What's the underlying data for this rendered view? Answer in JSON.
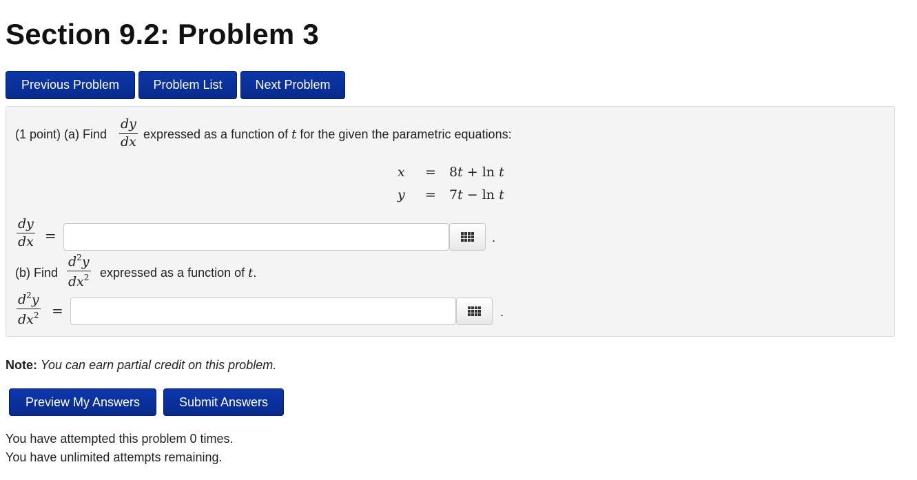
{
  "page": {
    "title": "Section 9.2: Problem 3"
  },
  "nav": {
    "previous_label": "Previous Problem",
    "list_label": "Problem List",
    "next_label": "Next Problem"
  },
  "problem": {
    "part_a": {
      "prefix": "(1 point) (a) Find",
      "frac_num": "dy",
      "frac_den": "dx",
      "suffix_1": "expressed as a function of",
      "var": "t",
      "suffix_2": "for the given the parametric equations:"
    },
    "equations": [
      {
        "lhs": "x",
        "eq": "=",
        "rhs_a": "8",
        "rhs_t1": "t",
        "rhs_b": " + ln ",
        "rhs_t2": "t"
      },
      {
        "lhs": "y",
        "eq": "=",
        "rhs_a": "7",
        "rhs_t1": "t",
        "rhs_b": " − ln ",
        "rhs_t2": "t"
      }
    ],
    "answer_a": {
      "lhs_num": "dy",
      "lhs_den": "dx",
      "eq": "=",
      "value": "",
      "placeholder": "",
      "trailing": "."
    },
    "part_b": {
      "prefix": "(b) Find",
      "frac_num_a": "d",
      "frac_num_sup": "2",
      "frac_num_b": "y",
      "frac_den_a": "dx",
      "frac_den_sup": "2",
      "suffix": "expressed as a function of",
      "var": "t",
      "end": "."
    },
    "answer_b": {
      "lhs_num_a": "d",
      "lhs_num_sup": "2",
      "lhs_num_b": "y",
      "lhs_den_a": "dx",
      "lhs_den_sup": "2",
      "eq": "=",
      "value": "",
      "placeholder": "",
      "trailing": "."
    },
    "equation_editor_icon": "grid-icon"
  },
  "note": {
    "label": "Note:",
    "text": "You can earn partial credit on this problem."
  },
  "actions": {
    "preview_label": "Preview My Answers",
    "submit_label": "Submit Answers"
  },
  "status": {
    "attempts": "You have attempted this problem 0 times.",
    "remaining": "You have unlimited attempts remaining."
  },
  "colors": {
    "button_bg": "#0b2f99",
    "panel_bg": "#f4f4f4"
  }
}
